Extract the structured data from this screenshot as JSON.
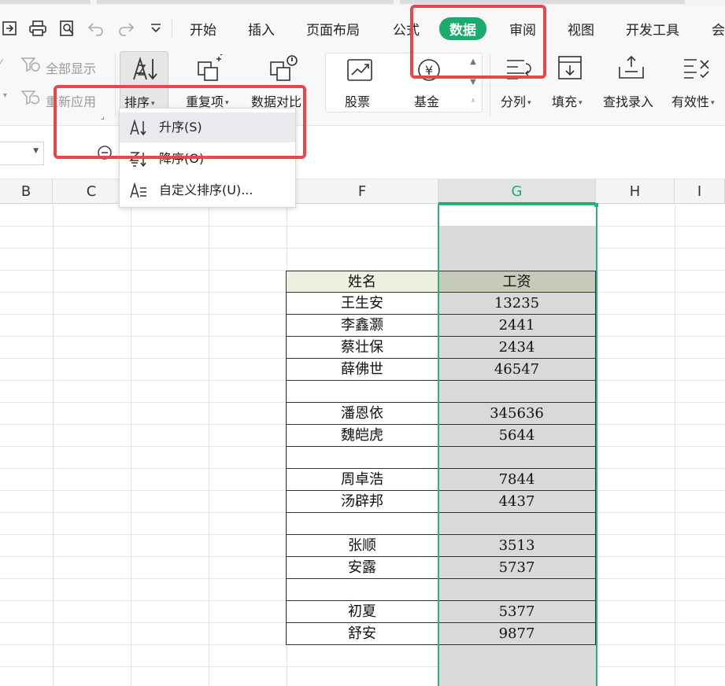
{
  "tabs": [
    "开始",
    "插入",
    "页面布局",
    "公式",
    "数据",
    "审阅",
    "视图",
    "开发工具",
    "会"
  ],
  "active_tab": "数据",
  "ribbon": {
    "show_all": "全部显示",
    "reapply": "重新应用",
    "sort": "排序",
    "duplicates": "重复项",
    "compare": "数据对比",
    "stock": "股票",
    "fund": "基金",
    "split": "分列",
    "fill": "填充",
    "lookup": "查找录入",
    "validity": "有效性"
  },
  "sort_menu": {
    "ascending": "升序(S)",
    "descending": "降序(O)",
    "custom": "自定义排序(U)..."
  },
  "columns": [
    "B",
    "C",
    "",
    "F",
    "G",
    "H",
    "I"
  ],
  "selected_column": "G",
  "table": {
    "headers": {
      "name": "姓名",
      "salary": "工资"
    },
    "rows": [
      {
        "name": "王生安",
        "salary": "13235"
      },
      {
        "name": "李鑫灏",
        "salary": "2441"
      },
      {
        "name": "蔡壮保",
        "salary": "2434"
      },
      {
        "name": "薛佛世",
        "salary": "46547"
      },
      {
        "name": "",
        "salary": ""
      },
      {
        "name": "潘恩依",
        "salary": "345636"
      },
      {
        "name": "魏皑虎",
        "salary": "5644"
      },
      {
        "name": "",
        "salary": ""
      },
      {
        "name": "周卓浩",
        "salary": "7844"
      },
      {
        "name": "汤辟邦",
        "salary": "4437"
      },
      {
        "name": "",
        "salary": ""
      },
      {
        "name": "张顺",
        "salary": "3513"
      },
      {
        "name": "安露",
        "salary": "5737"
      },
      {
        "name": "",
        "salary": ""
      },
      {
        "name": "初夏",
        "salary": "5377"
      },
      {
        "name": "舒安",
        "salary": "9877"
      }
    ]
  },
  "colors": {
    "accent": "#1aab6d",
    "highlight_box": "#e8464a",
    "selection": "#2bb07c"
  }
}
